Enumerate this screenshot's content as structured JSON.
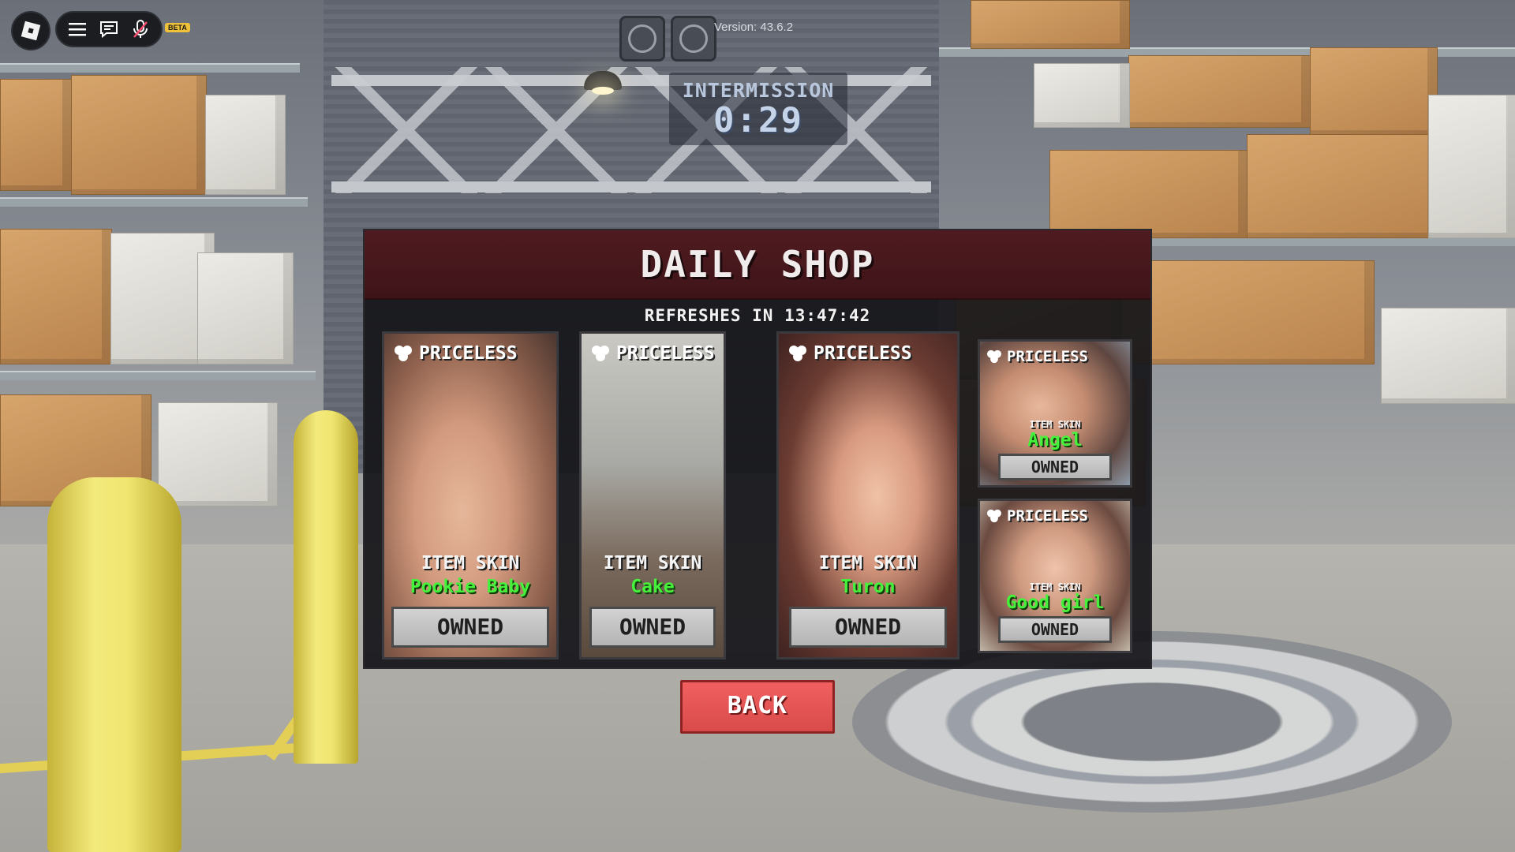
{
  "topbar": {
    "logo_icon": "roblox-logo-icon",
    "menu_icon": "hamburger-menu-icon",
    "chat_icon": "chat-icon",
    "mic_icon": "microphone-icon",
    "beta_label": "BETA",
    "version_text": "Version: 43.6.2"
  },
  "intermission": {
    "label": "INTERMISSION",
    "time": "0:29"
  },
  "shop": {
    "title": "DAILY SHOP",
    "refresh_text": "REFRESHES IN 13:47:42",
    "price_icon": "gem-cluster-icon",
    "items": [
      {
        "price": "PRICELESS",
        "type": "ITEM SKIN",
        "name": "Pookie Baby",
        "status": "OWNED"
      },
      {
        "price": "PRICELESS",
        "type": "ITEM SKIN",
        "name": "Cake",
        "status": "OWNED"
      },
      {
        "price": "PRICELESS",
        "type": "ITEM SKIN",
        "name": "Turon",
        "status": "OWNED"
      },
      {
        "price": "PRICELESS",
        "type": "ITEM SKIN",
        "name": "Angel",
        "status": "OWNED"
      },
      {
        "price": "PRICELESS",
        "type": "ITEM SKIN",
        "name": "Good girl",
        "status": "OWNED"
      }
    ],
    "back_label": "BACK"
  },
  "colors": {
    "header": "#4f1b20",
    "name_green": "#45f13a",
    "back_button": "#e65555",
    "owned_button": "#c4c4c4"
  }
}
